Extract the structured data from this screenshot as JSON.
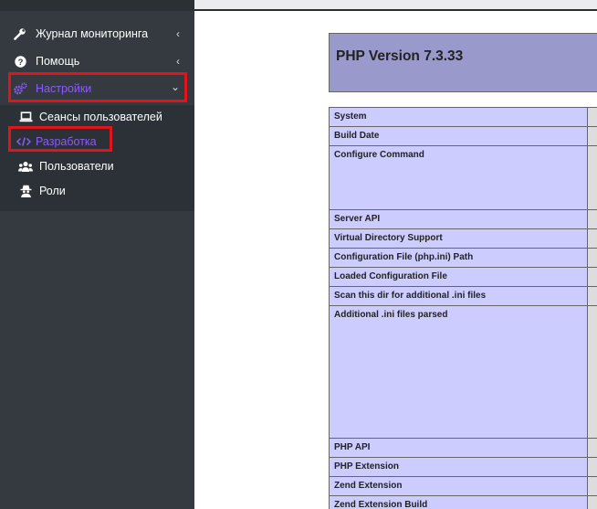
{
  "sidebar": {
    "items": [
      {
        "label": "Журнал мониторинга",
        "icon": "wrench-icon",
        "chevron": "‹"
      },
      {
        "label": "Помощь",
        "icon": "question-circle-icon",
        "chevron": "‹"
      },
      {
        "label": "Настройки",
        "icon": "cogs-icon",
        "chevron": "⌄",
        "active": true
      },
      {
        "label": "Сеансы пользователей",
        "icon": "laptop-icon"
      },
      {
        "label": "Разработка",
        "icon": "code-icon",
        "active": true
      },
      {
        "label": "Пользователи",
        "icon": "users-icon"
      },
      {
        "label": "Роли",
        "icon": "user-secret-icon"
      }
    ],
    "active_color": "#8b5cf6",
    "background": "#343a40"
  },
  "phpinfo": {
    "title": "PHP Version 7.3.33",
    "rows": [
      "System",
      "Build Date",
      "Configure Command",
      "Server API",
      "Virtual Directory Support",
      "Configuration File (php.ini) Path",
      "Loaded Configuration File",
      "Scan this dir for additional .ini files",
      "Additional .ini files parsed",
      "PHP API",
      "PHP Extension",
      "Zend Extension",
      "Zend Extension Build"
    ],
    "header_color": "#9999cc",
    "key_color": "#ccccff"
  },
  "highlights": {
    "color": "#e0151b"
  }
}
